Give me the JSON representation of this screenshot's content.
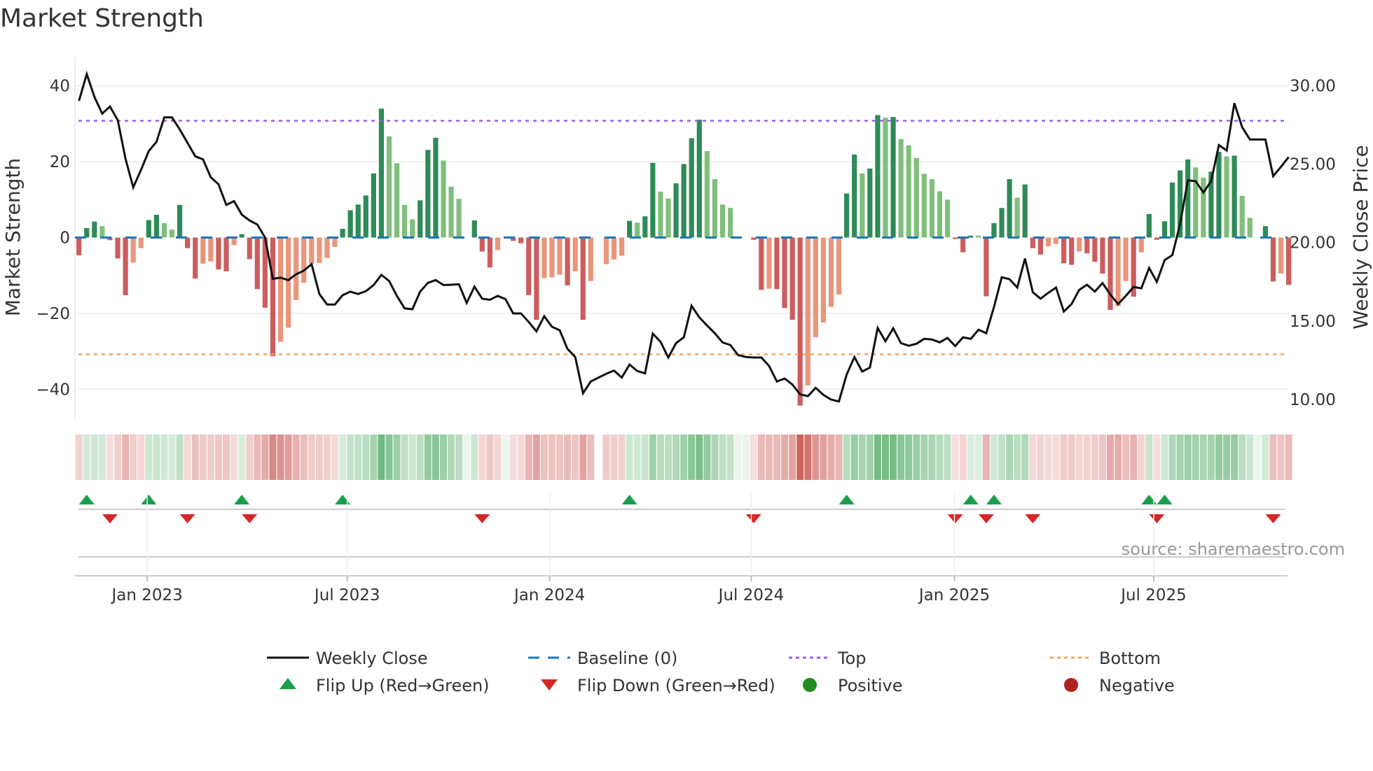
{
  "chart_data": {
    "type": "bar",
    "title": "Market Strength",
    "ylabel": "Market Strength",
    "ylabel_right": "Weekly Close Price",
    "xlabel": "",
    "ylim": [
      -47.7,
      47.7
    ],
    "ylim_right": [
      8.79,
      31.85
    ],
    "yticks": [
      {
        "v": 40,
        "label": "40"
      },
      {
        "v": 20,
        "label": "20"
      },
      {
        "v": 0,
        "label": "0"
      },
      {
        "v": -20,
        "label": "−20"
      },
      {
        "v": -40,
        "label": "−40"
      }
    ],
    "yticks_right": [
      {
        "v": 30,
        "label": "30.00"
      },
      {
        "v": 25,
        "label": "25.00"
      },
      {
        "v": 20,
        "label": "20.00"
      },
      {
        "v": 15,
        "label": "15.00"
      },
      {
        "v": 10,
        "label": "10.00"
      }
    ],
    "xticks": [
      {
        "week": 8.8,
        "label": "Jan 2023"
      },
      {
        "week": 34.6,
        "label": "Jul 2023"
      },
      {
        "week": 60.7,
        "label": "Jan 2024"
      },
      {
        "week": 86.7,
        "label": "Jul 2024"
      },
      {
        "week": 112.9,
        "label": "Jan 2025"
      },
      {
        "week": 138.6,
        "label": "Jul 2025"
      }
    ],
    "grid": true,
    "top_level": 30.8,
    "bottom_level": -30.8,
    "baseline": 0,
    "strength": [
      -4.7,
      2.5,
      4.2,
      3.0,
      -0.7,
      -5.5,
      -15.2,
      -6.6,
      -2.8,
      4.6,
      6.0,
      3.8,
      2.1,
      8.6,
      -2.8,
      -10.8,
      -6.9,
      -6.3,
      -8.4,
      -8.9,
      -2.0,
      0.9,
      -5.7,
      -13.6,
      -18.5,
      -31.3,
      -27.5,
      -23.8,
      -16.5,
      -11.9,
      -6.9,
      -6.7,
      -5.4,
      -2.5,
      2.3,
      7.2,
      8.7,
      11.1,
      16.9,
      34.0,
      26.7,
      19.6,
      8.6,
      4.8,
      9.8,
      23.1,
      26.3,
      20.3,
      13.4,
      10.2,
      0,
      4.5,
      -3.7,
      -7.9,
      -3.3,
      0,
      -0.9,
      -1.5,
      -15.2,
      -21.7,
      -10.7,
      -10.5,
      -9.8,
      -12.6,
      -8.9,
      -21.7,
      -11.5,
      0,
      -7.0,
      -5.8,
      -4.8,
      4.4,
      3.9,
      5.6,
      19.7,
      12.1,
      10.3,
      14.3,
      19.4,
      26.2,
      31.1,
      22.8,
      15.4,
      8.7,
      7.8,
      0,
      0,
      -0.6,
      -13.8,
      -13.5,
      -13.6,
      -18.6,
      -21.7,
      -44.3,
      -39.0,
      -26.3,
      -22.4,
      -18.3,
      -15.0,
      11.6,
      21.9,
      16.9,
      18.2,
      32.3,
      31.6,
      31.8,
      26.0,
      24.3,
      21.0,
      16.8,
      15.4,
      12.2,
      10.0,
      -0.4,
      -3.9,
      0.5,
      0.5,
      -15.5,
      3.8,
      7.8,
      15.4,
      10.5,
      14.0,
      -2.8,
      -4.5,
      -2.3,
      -1.7,
      -6.8,
      -7.2,
      -3.7,
      -4.2,
      -6.4,
      -9.5,
      -19.1,
      -18.1,
      -11.5,
      -15.6,
      -3.9,
      6.2,
      -0.6,
      4.3,
      14.5,
      17.7,
      20.6,
      18.5,
      15.8,
      17.4,
      22.6,
      21.4,
      21.6,
      11.0,
      5.2,
      0,
      3.0,
      -11.6,
      -9.5,
      -12.5
    ],
    "shades": "DDDLDDDLLDDLLDDDLLDDLDDDDDLLLLLLLLDDDDDDLLLLDDDLLLZDDDLZDDDDLLLDLDLZLLLDLDDLLDDDDLLLLZZDDLDDDDLLLLLDDLDDLDLLLLLLLDDDLDDDDLDDDLLDDLDDDDLLDLDDDDDDLLDDLDLLZDDLD",
    "weekly_close": [
      29.03,
      30.74,
      29.29,
      28.22,
      28.67,
      27.8,
      25.35,
      23.52,
      24.63,
      25.83,
      26.42,
      27.98,
      27.98,
      27.21,
      26.35,
      25.5,
      25.3,
      24.16,
      23.71,
      22.4,
      22.64,
      21.78,
      21.41,
      21.15,
      20.32,
      17.69,
      17.76,
      17.61,
      17.98,
      18.21,
      18.62,
      16.72,
      16.05,
      16.05,
      16.64,
      16.87,
      16.72,
      16.9,
      17.29,
      17.94,
      17.55,
      16.6,
      15.8,
      15.75,
      16.87,
      17.43,
      17.61,
      17.29,
      17.31,
      17.34,
      16.15,
      17.19,
      16.42,
      16.35,
      16.6,
      16.39,
      15.48,
      15.48,
      14.93,
      14.34,
      15.3,
      14.63,
      14.41,
      13.22,
      12.7,
      10.39,
      11.14,
      11.39,
      11.63,
      11.84,
      11.39,
      12.22,
      11.81,
      11.66,
      14.19,
      13.67,
      12.67,
      13.59,
      13.96,
      15.97,
      15.23,
      14.71,
      14.22,
      13.63,
      13.47,
      12.82,
      12.7,
      12.67,
      12.67,
      12.13,
      11.14,
      11.33,
      10.95,
      10.32,
      10.21,
      10.74,
      10.29,
      9.99,
      9.87,
      11.58,
      12.7,
      11.78,
      12.03,
      14.56,
      13.71,
      14.53,
      13.59,
      13.42,
      13.55,
      13.86,
      13.82,
      13.64,
      13.92,
      13.4,
      13.96,
      13.86,
      14.44,
      14.22,
      15.9,
      17.79,
      17.66,
      17.13,
      18.98,
      16.84,
      16.42,
      16.79,
      17.13,
      15.6,
      16.08,
      16.99,
      17.31,
      16.87,
      17.42,
      16.69,
      16.08,
      16.6,
      17.17,
      17.08,
      18.38,
      17.49,
      18.88,
      19.2,
      21.18,
      23.97,
      23.91,
      23.19,
      23.91,
      26.21,
      25.87,
      28.89,
      27.36,
      26.57,
      26.57,
      26.57,
      24.23,
      24.83,
      25.45
    ],
    "legend": {
      "placement": "bottom-center",
      "items": [
        {
          "key": "close",
          "label": "Weekly Close"
        },
        {
          "key": "baseline",
          "label": "Baseline (0)"
        },
        {
          "key": "top",
          "label": "Top"
        },
        {
          "key": "bottom",
          "label": "Bottom"
        },
        {
          "key": "flip_up",
          "label": "Flip Up (Red→Green)"
        },
        {
          "key": "flip_down",
          "label": "Flip Down (Green→Red)"
        },
        {
          "key": "positive",
          "label": "Positive"
        },
        {
          "key": "negative",
          "label": "Negative"
        }
      ]
    },
    "source": "source: sharemaestro.com"
  },
  "colors": {
    "pos_dark": "#2e8b57",
    "pos_light": "#7fbf7b",
    "neg_dark": "#cd5c5c",
    "neg_light": "#e9967a",
    "close": "#111111",
    "baseline": "#1f77b4",
    "top": "#9b5de5",
    "bottom": "#f4a261",
    "flip_up": "#1a9e4a",
    "flip_down": "#d62728",
    "positive": "#228b22",
    "negative": "#b22222",
    "strip_pos": "#3aa04f",
    "strip_neg": "#c8504a"
  }
}
